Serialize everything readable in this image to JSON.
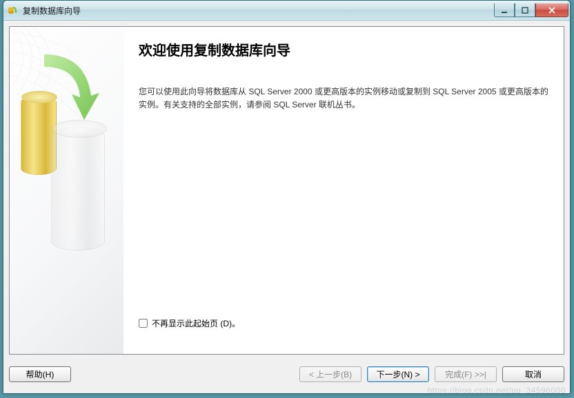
{
  "window": {
    "title": "复制数据库向导"
  },
  "main": {
    "heading": "欢迎使用复制数据库向导",
    "description": "您可以使用此向导将数据库从 SQL Server 2000 或更高版本的实例移动或复制到 SQL Server 2005 或更高版本的实例。有关支持的全部实例，请参阅 SQL Server 联机丛书。"
  },
  "checkbox": {
    "label": "不再显示此起始页 (D)。"
  },
  "buttons": {
    "help": "帮助(H)",
    "back": "< 上一步(B)",
    "next": "下一步(N) >",
    "finish": "完成(F) >>|",
    "cancel": "取消"
  },
  "watermark": "https://blog.csdn.net/qq_34596000"
}
